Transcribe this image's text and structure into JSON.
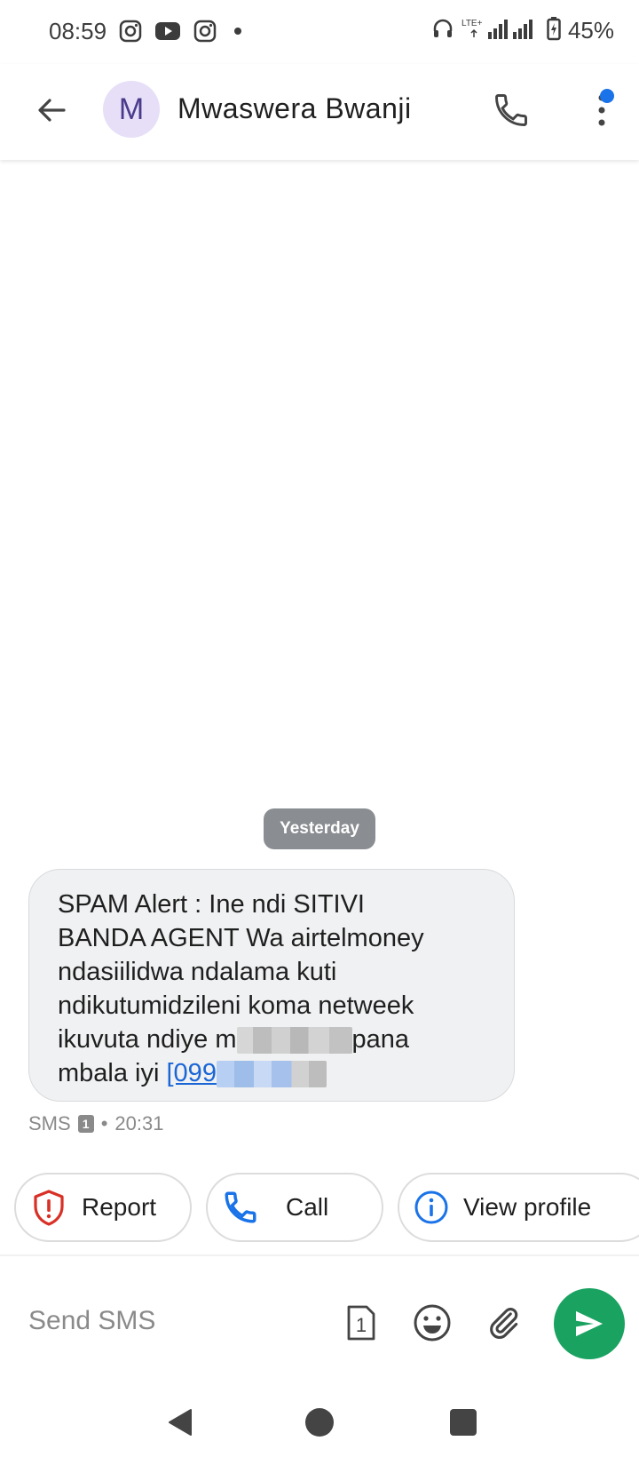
{
  "status_bar": {
    "time": "08:59",
    "left_icons": [
      "instagram-icon",
      "youtube-icon",
      "instagram-icon",
      "dot-icon"
    ],
    "network": "LTE+",
    "battery_percent": "45%"
  },
  "app_bar": {
    "avatar_letter": "M",
    "contact_name": "Mwaswera Bwanji",
    "avatar_bg": "#e6dff7",
    "avatar_fg": "#4a3b8c"
  },
  "conversation": {
    "date_chip": "Yesterday",
    "message": {
      "line1": "SPAM Alert : Ine ndi SITIVI",
      "line2": "BANDA AGENT Wa airtelmoney",
      "line3": "ndasiilidwa ndalama kuti",
      "line4": "ndikutumidzileni koma netweek",
      "line5_start": "ikuvuta ndiye m",
      "line5_end": "pana",
      "line6_start": "mbala iyi ",
      "link_start": "[099"
    },
    "meta": {
      "type": "SMS",
      "sim": "1",
      "separator": "•",
      "time": "20:31"
    }
  },
  "actions": {
    "report": "Report",
    "call": "Call",
    "view_profile": "View profile"
  },
  "compose": {
    "placeholder": "Send SMS",
    "sim_label": "1"
  },
  "colors": {
    "accent_blue": "#1a73e8",
    "send_green": "#1aa260",
    "report_red": "#d93025",
    "date_chip": "#8a8d91"
  }
}
